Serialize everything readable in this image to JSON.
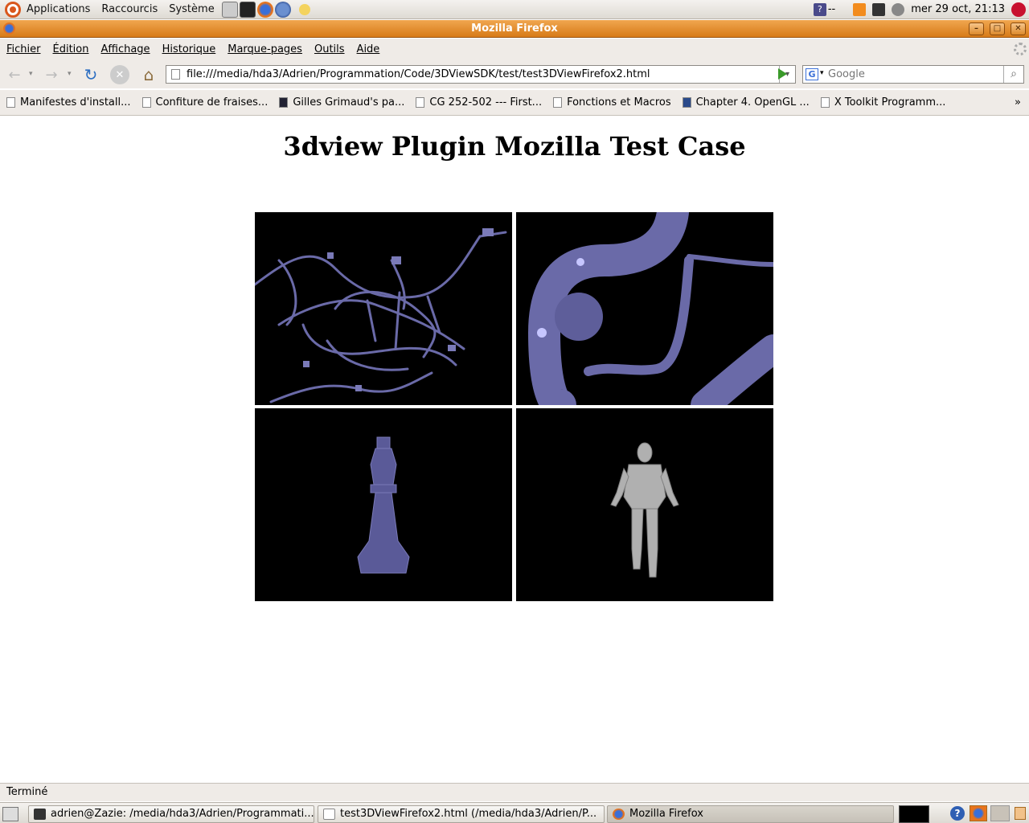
{
  "top_panel": {
    "menus": [
      "Applications",
      "Raccourcis",
      "Système"
    ],
    "indicator_text": "--",
    "clock": "mer 29 oct, 21:13"
  },
  "window": {
    "title": "Mozilla Firefox"
  },
  "menu_bar": {
    "items": [
      "Fichier",
      "Édition",
      "Affichage",
      "Historique",
      "Marque-pages",
      "Outils",
      "Aide"
    ]
  },
  "nav": {
    "url": "file:///media/hda3/Adrien/Programmation/Code/3DViewSDK/test/test3DViewFirefox2.html",
    "search_placeholder": "Google"
  },
  "bookmarks": [
    "Manifestes d'install...",
    "Confiture de fraises...",
    "Gilles Grimaud's pa...",
    "CG 252-502 --- First...",
    "Fonctions et Macros",
    "Chapter 4. OpenGL ...",
    "X Toolkit Programm..."
  ],
  "page": {
    "heading": "3dview Plugin Mozilla Test Case"
  },
  "status": "Terminé",
  "taskbar": [
    "adrien@Zazie: /media/hda3/Adrien/Programmati...",
    "test3DViewFirefox2.html (/media/hda3/Adrien/P...",
    "Mozilla Firefox"
  ],
  "colors": {
    "title_bar": "#e08b2a",
    "model_purple": "#6a6aa8",
    "model_gray": "#b0b0b0"
  }
}
